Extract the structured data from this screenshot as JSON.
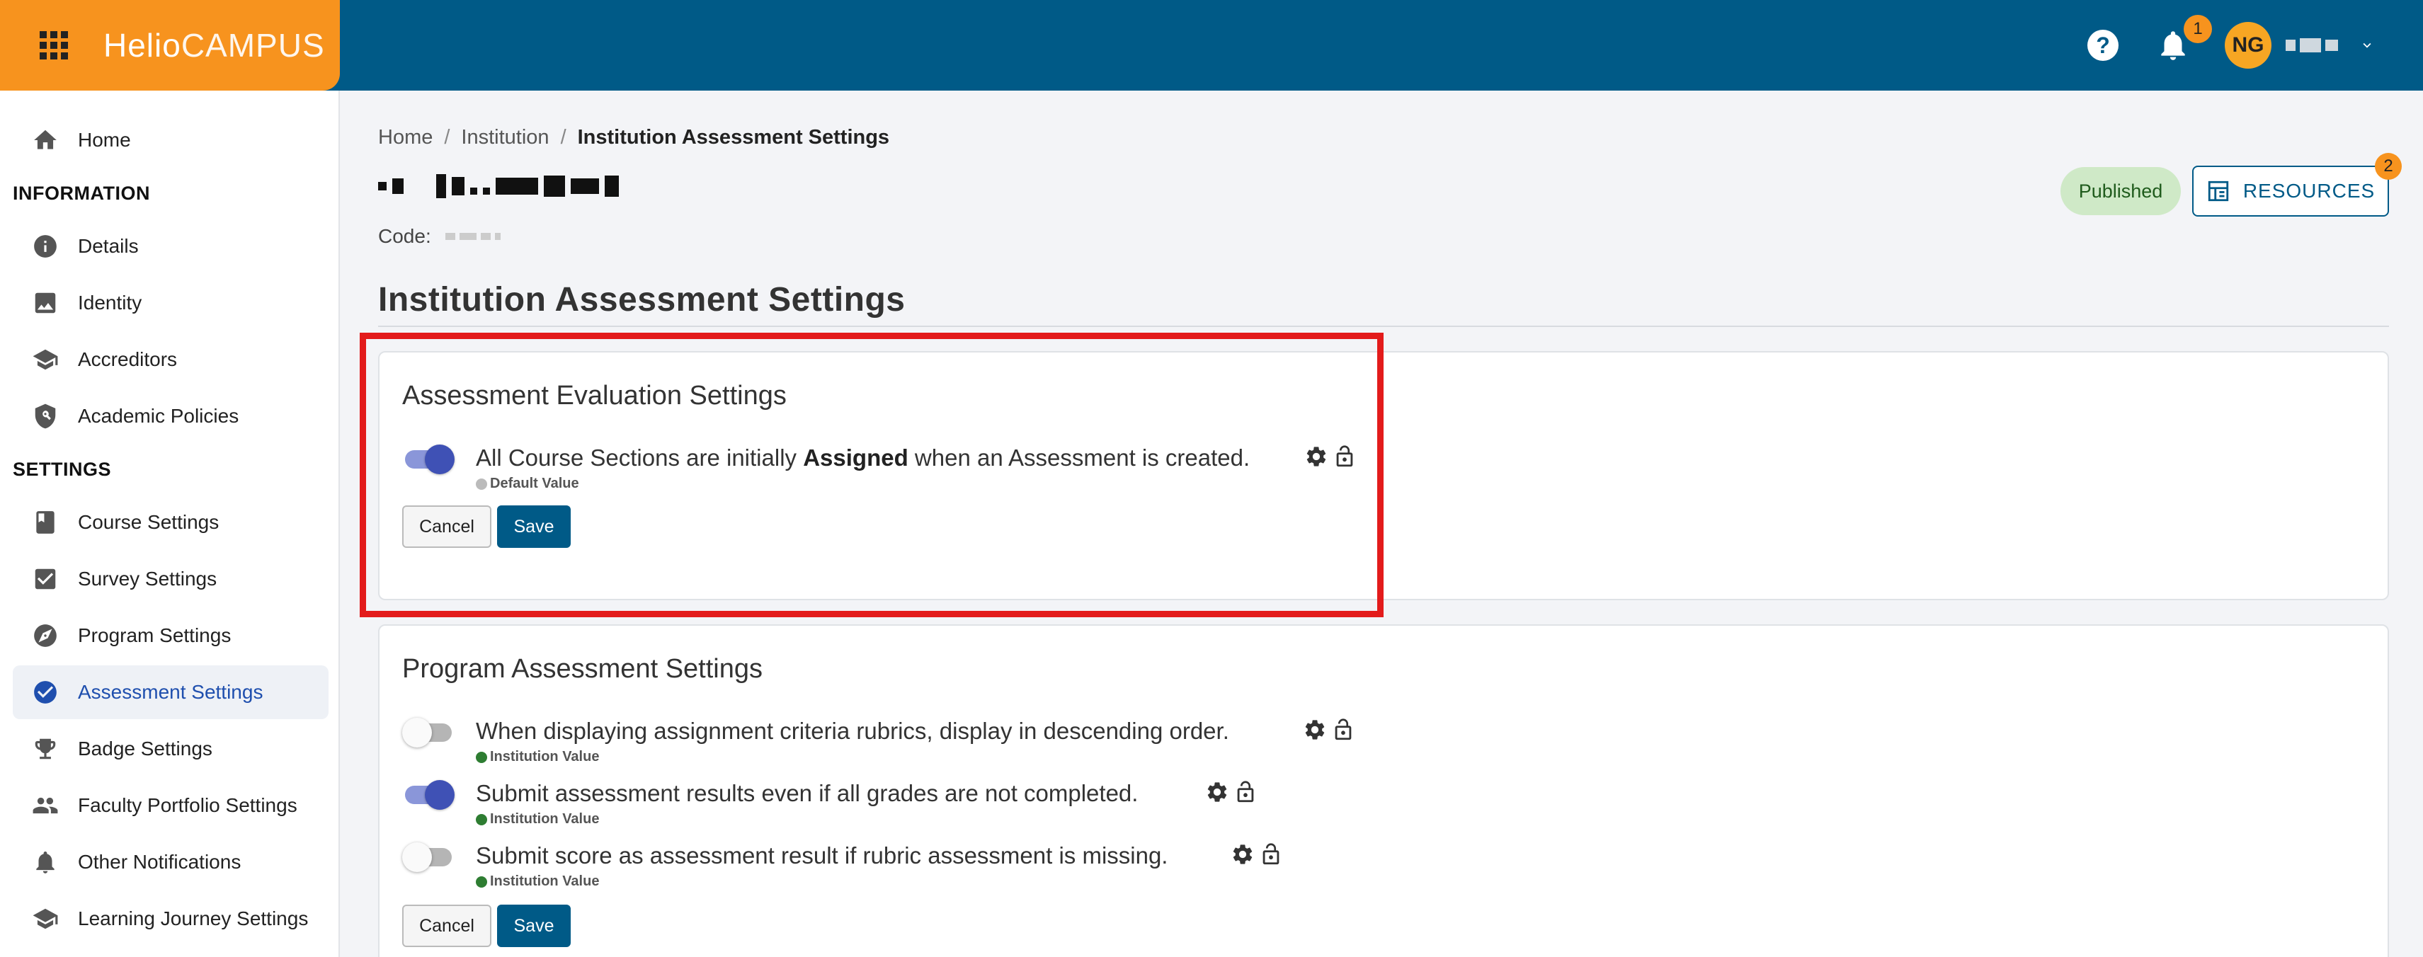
{
  "header": {
    "logo_part1": "Helio",
    "logo_part2": "CAMPUS",
    "help_glyph": "?",
    "notification_count": "1",
    "avatar_initials": "NG"
  },
  "sidebar": {
    "home": "Home",
    "section_information": "INFORMATION",
    "information_items": [
      "Details",
      "Identity",
      "Accreditors",
      "Academic Policies"
    ],
    "section_settings": "SETTINGS",
    "settings_items": [
      "Course Settings",
      "Survey Settings",
      "Program Settings",
      "Assessment Settings",
      "Badge Settings",
      "Faculty Portfolio Settings",
      "Other Notifications",
      "Learning Journey Settings"
    ],
    "active_item": "Assessment Settings"
  },
  "breadcrumb": [
    "Home",
    "Institution",
    "Institution Assessment Settings"
  ],
  "institution": {
    "code_label": "Code:"
  },
  "status_badge": "Published",
  "resources": {
    "label": "RESOURCES",
    "badge_count": "2"
  },
  "page_title": "Institution Assessment Settings",
  "evaluation_card": {
    "title": "Assessment Evaluation Settings",
    "setting": {
      "text_before": "All Course Sections are initially ",
      "text_bold": "Assigned",
      "text_after": " when an Assessment is created.",
      "enabled": true,
      "value_source": "Default Value"
    },
    "cancel_label": "Cancel",
    "save_label": "Save"
  },
  "program_card": {
    "title": "Program Assessment Settings",
    "settings": [
      {
        "text": "When displaying assignment criteria rubrics, display in descending order.",
        "enabled": false,
        "value_source": "Institution Value"
      },
      {
        "text": "Submit assessment results even if all grades are not completed.",
        "enabled": true,
        "value_source": "Institution Value"
      },
      {
        "text": "Submit score as assessment result if rubric assessment is missing.",
        "enabled": false,
        "value_source": "Institution Value"
      }
    ],
    "cancel_label": "Cancel",
    "save_label": "Save"
  },
  "colors": {
    "header_bg": "#005a87",
    "brand_orange": "#f7931e",
    "highlight_red": "#e31b1b",
    "toggle_on": "#3f51b5"
  }
}
